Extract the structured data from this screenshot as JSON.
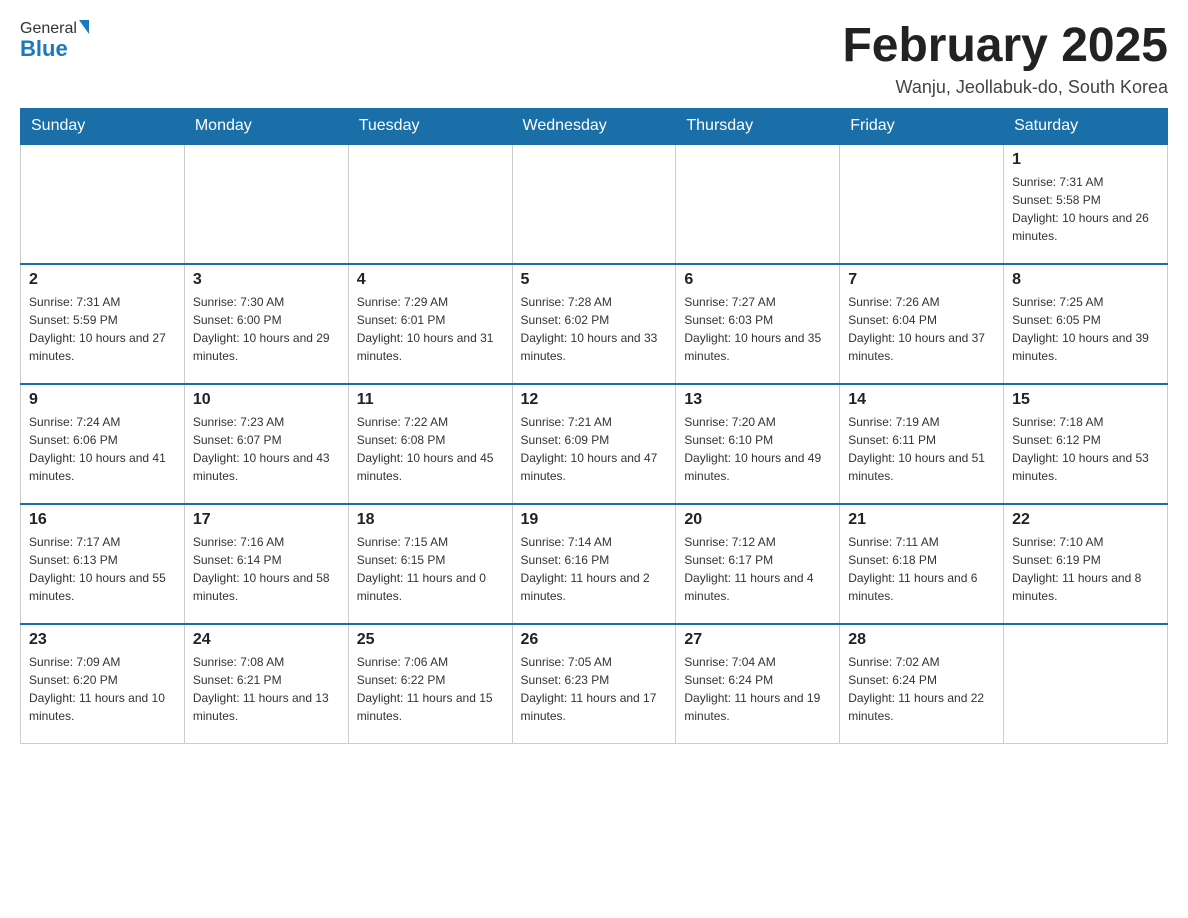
{
  "header": {
    "logo_general": "General",
    "logo_blue": "Blue",
    "title": "February 2025",
    "location": "Wanju, Jeollabuk-do, South Korea"
  },
  "weekdays": [
    "Sunday",
    "Monday",
    "Tuesday",
    "Wednesday",
    "Thursday",
    "Friday",
    "Saturday"
  ],
  "weeks": [
    {
      "days": [
        {
          "date": "",
          "sunrise": "",
          "sunset": "",
          "daylight": "",
          "empty": true
        },
        {
          "date": "",
          "sunrise": "",
          "sunset": "",
          "daylight": "",
          "empty": true
        },
        {
          "date": "",
          "sunrise": "",
          "sunset": "",
          "daylight": "",
          "empty": true
        },
        {
          "date": "",
          "sunrise": "",
          "sunset": "",
          "daylight": "",
          "empty": true
        },
        {
          "date": "",
          "sunrise": "",
          "sunset": "",
          "daylight": "",
          "empty": true
        },
        {
          "date": "",
          "sunrise": "",
          "sunset": "",
          "daylight": "",
          "empty": true
        },
        {
          "date": "1",
          "sunrise": "Sunrise: 7:31 AM",
          "sunset": "Sunset: 5:58 PM",
          "daylight": "Daylight: 10 hours and 26 minutes.",
          "empty": false
        }
      ]
    },
    {
      "days": [
        {
          "date": "2",
          "sunrise": "Sunrise: 7:31 AM",
          "sunset": "Sunset: 5:59 PM",
          "daylight": "Daylight: 10 hours and 27 minutes.",
          "empty": false
        },
        {
          "date": "3",
          "sunrise": "Sunrise: 7:30 AM",
          "sunset": "Sunset: 6:00 PM",
          "daylight": "Daylight: 10 hours and 29 minutes.",
          "empty": false
        },
        {
          "date": "4",
          "sunrise": "Sunrise: 7:29 AM",
          "sunset": "Sunset: 6:01 PM",
          "daylight": "Daylight: 10 hours and 31 minutes.",
          "empty": false
        },
        {
          "date": "5",
          "sunrise": "Sunrise: 7:28 AM",
          "sunset": "Sunset: 6:02 PM",
          "daylight": "Daylight: 10 hours and 33 minutes.",
          "empty": false
        },
        {
          "date": "6",
          "sunrise": "Sunrise: 7:27 AM",
          "sunset": "Sunset: 6:03 PM",
          "daylight": "Daylight: 10 hours and 35 minutes.",
          "empty": false
        },
        {
          "date": "7",
          "sunrise": "Sunrise: 7:26 AM",
          "sunset": "Sunset: 6:04 PM",
          "daylight": "Daylight: 10 hours and 37 minutes.",
          "empty": false
        },
        {
          "date": "8",
          "sunrise": "Sunrise: 7:25 AM",
          "sunset": "Sunset: 6:05 PM",
          "daylight": "Daylight: 10 hours and 39 minutes.",
          "empty": false
        }
      ]
    },
    {
      "days": [
        {
          "date": "9",
          "sunrise": "Sunrise: 7:24 AM",
          "sunset": "Sunset: 6:06 PM",
          "daylight": "Daylight: 10 hours and 41 minutes.",
          "empty": false
        },
        {
          "date": "10",
          "sunrise": "Sunrise: 7:23 AM",
          "sunset": "Sunset: 6:07 PM",
          "daylight": "Daylight: 10 hours and 43 minutes.",
          "empty": false
        },
        {
          "date": "11",
          "sunrise": "Sunrise: 7:22 AM",
          "sunset": "Sunset: 6:08 PM",
          "daylight": "Daylight: 10 hours and 45 minutes.",
          "empty": false
        },
        {
          "date": "12",
          "sunrise": "Sunrise: 7:21 AM",
          "sunset": "Sunset: 6:09 PM",
          "daylight": "Daylight: 10 hours and 47 minutes.",
          "empty": false
        },
        {
          "date": "13",
          "sunrise": "Sunrise: 7:20 AM",
          "sunset": "Sunset: 6:10 PM",
          "daylight": "Daylight: 10 hours and 49 minutes.",
          "empty": false
        },
        {
          "date": "14",
          "sunrise": "Sunrise: 7:19 AM",
          "sunset": "Sunset: 6:11 PM",
          "daylight": "Daylight: 10 hours and 51 minutes.",
          "empty": false
        },
        {
          "date": "15",
          "sunrise": "Sunrise: 7:18 AM",
          "sunset": "Sunset: 6:12 PM",
          "daylight": "Daylight: 10 hours and 53 minutes.",
          "empty": false
        }
      ]
    },
    {
      "days": [
        {
          "date": "16",
          "sunrise": "Sunrise: 7:17 AM",
          "sunset": "Sunset: 6:13 PM",
          "daylight": "Daylight: 10 hours and 55 minutes.",
          "empty": false
        },
        {
          "date": "17",
          "sunrise": "Sunrise: 7:16 AM",
          "sunset": "Sunset: 6:14 PM",
          "daylight": "Daylight: 10 hours and 58 minutes.",
          "empty": false
        },
        {
          "date": "18",
          "sunrise": "Sunrise: 7:15 AM",
          "sunset": "Sunset: 6:15 PM",
          "daylight": "Daylight: 11 hours and 0 minutes.",
          "empty": false
        },
        {
          "date": "19",
          "sunrise": "Sunrise: 7:14 AM",
          "sunset": "Sunset: 6:16 PM",
          "daylight": "Daylight: 11 hours and 2 minutes.",
          "empty": false
        },
        {
          "date": "20",
          "sunrise": "Sunrise: 7:12 AM",
          "sunset": "Sunset: 6:17 PM",
          "daylight": "Daylight: 11 hours and 4 minutes.",
          "empty": false
        },
        {
          "date": "21",
          "sunrise": "Sunrise: 7:11 AM",
          "sunset": "Sunset: 6:18 PM",
          "daylight": "Daylight: 11 hours and 6 minutes.",
          "empty": false
        },
        {
          "date": "22",
          "sunrise": "Sunrise: 7:10 AM",
          "sunset": "Sunset: 6:19 PM",
          "daylight": "Daylight: 11 hours and 8 minutes.",
          "empty": false
        }
      ]
    },
    {
      "days": [
        {
          "date": "23",
          "sunrise": "Sunrise: 7:09 AM",
          "sunset": "Sunset: 6:20 PM",
          "daylight": "Daylight: 11 hours and 10 minutes.",
          "empty": false
        },
        {
          "date": "24",
          "sunrise": "Sunrise: 7:08 AM",
          "sunset": "Sunset: 6:21 PM",
          "daylight": "Daylight: 11 hours and 13 minutes.",
          "empty": false
        },
        {
          "date": "25",
          "sunrise": "Sunrise: 7:06 AM",
          "sunset": "Sunset: 6:22 PM",
          "daylight": "Daylight: 11 hours and 15 minutes.",
          "empty": false
        },
        {
          "date": "26",
          "sunrise": "Sunrise: 7:05 AM",
          "sunset": "Sunset: 6:23 PM",
          "daylight": "Daylight: 11 hours and 17 minutes.",
          "empty": false
        },
        {
          "date": "27",
          "sunrise": "Sunrise: 7:04 AM",
          "sunset": "Sunset: 6:24 PM",
          "daylight": "Daylight: 11 hours and 19 minutes.",
          "empty": false
        },
        {
          "date": "28",
          "sunrise": "Sunrise: 7:02 AM",
          "sunset": "Sunset: 6:24 PM",
          "daylight": "Daylight: 11 hours and 22 minutes.",
          "empty": false
        },
        {
          "date": "",
          "sunrise": "",
          "sunset": "",
          "daylight": "",
          "empty": true
        }
      ]
    }
  ]
}
